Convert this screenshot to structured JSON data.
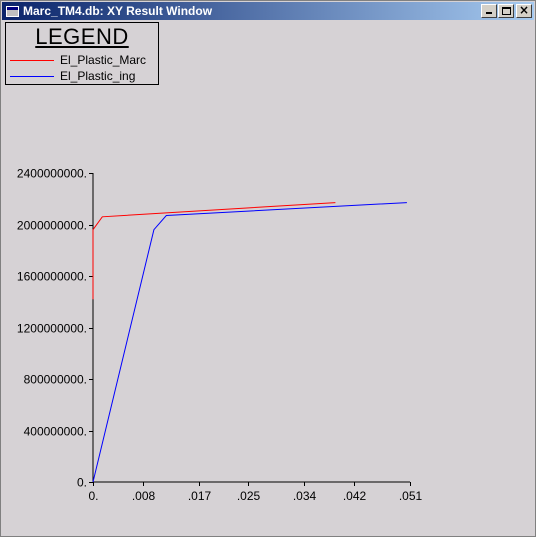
{
  "window": {
    "title": "Marc_TM4.db: XY Result Window",
    "buttons": [
      {
        "name": "minimize",
        "icon": "minimize-icon"
      },
      {
        "name": "maximize",
        "icon": "maximize-icon"
      },
      {
        "name": "close",
        "icon": "close-icon",
        "glyph": "×"
      }
    ],
    "title_gradient": [
      "#0a246a",
      "#a6caf0"
    ],
    "background": "#d6d2d5"
  },
  "chart_data": {
    "type": "line",
    "legend": {
      "title": "LEGEND",
      "placement": "top-left"
    },
    "xlim": [
      0,
      0.051
    ],
    "ylim": [
      0,
      2400000000
    ],
    "x_tick_values": [
      0,
      0.008,
      0.017,
      0.025,
      0.034,
      0.042,
      0.051
    ],
    "x_tick_labels": [
      "0.",
      ".008",
      ".017",
      ".025",
      ".034",
      ".042",
      ".051"
    ],
    "y_tick_values": [
      0,
      400000000,
      800000000,
      1200000000,
      1600000000,
      2000000000,
      2400000000
    ],
    "y_tick_labels": [
      "0.",
      "400000000.",
      "800000000.",
      "1200000000.",
      "1600000000.",
      "2000000000.",
      "2400000000."
    ],
    "grid": false,
    "series": [
      {
        "name": "El_Plastic_Marc",
        "color": "#ff0000",
        "points": [
          [
            0,
            1420000000
          ],
          [
            0,
            1960000000
          ],
          [
            0.0015,
            2060000000
          ],
          [
            0.039,
            2170000000
          ]
        ]
      },
      {
        "name": "El_Plastic_ing",
        "color": "#0000ff",
        "points": [
          [
            0,
            0
          ],
          [
            0.0098,
            1960000000
          ],
          [
            0.0118,
            2070000000
          ],
          [
            0.0505,
            2170000000
          ]
        ]
      }
    ]
  }
}
